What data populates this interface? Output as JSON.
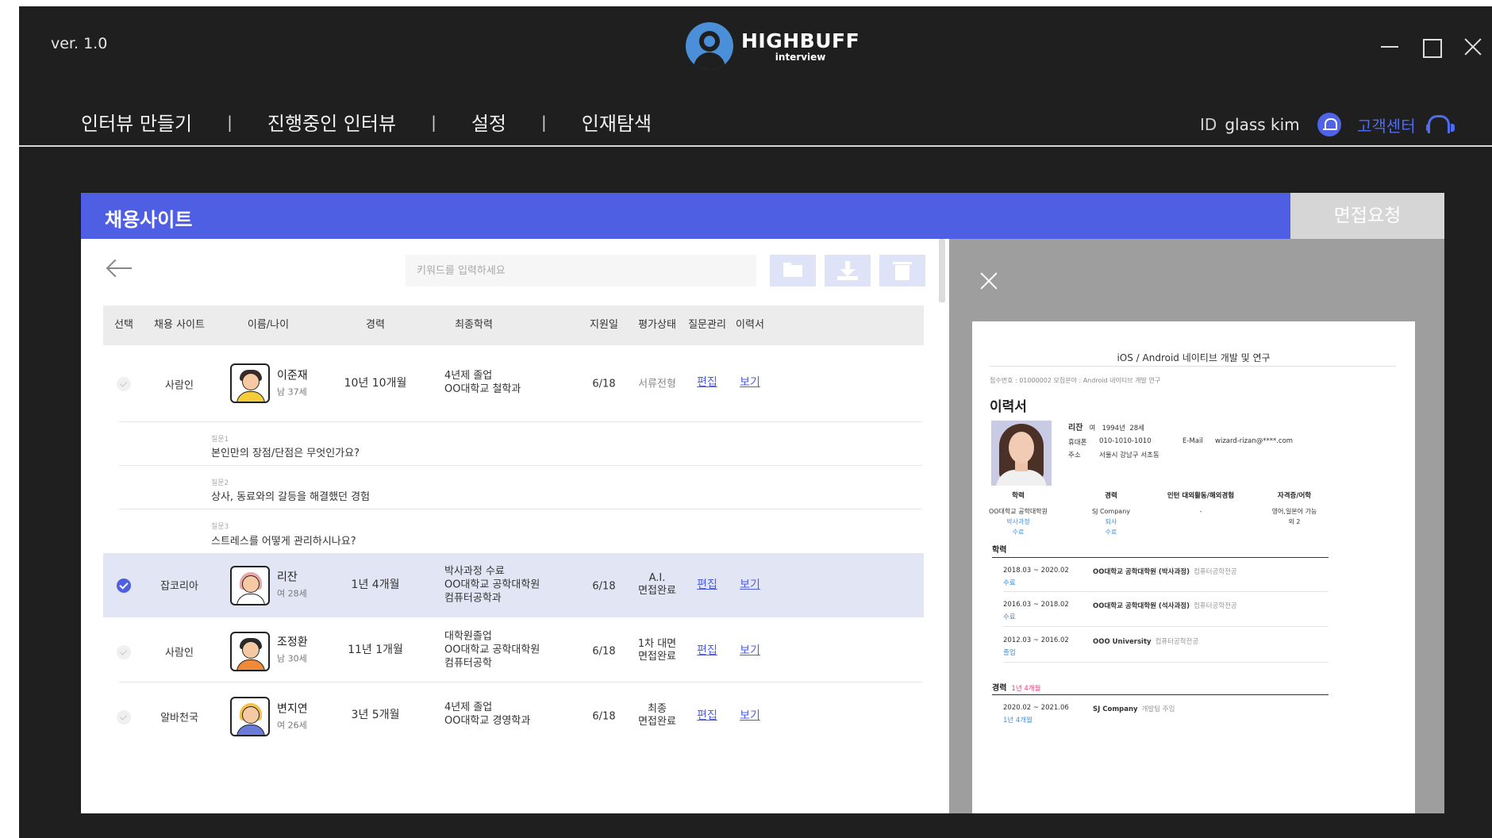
{
  "app": {
    "version": "ver. 1.0",
    "logo_main": "HIGHBUFF",
    "logo_sub": "interview"
  },
  "nav": {
    "items": [
      "인터뷰 만들기",
      "진행중인 인터뷰",
      "설정",
      "인재탐색"
    ],
    "separator": "|",
    "id_label": "ID",
    "user": "glass kim",
    "support": "고객센터"
  },
  "panel": {
    "title": "채용사이트",
    "request_button": "면접요청",
    "search_placeholder": "키워드를 입력하세요"
  },
  "table": {
    "headers": [
      "선택",
      "채용 사이트",
      "이름/나이",
      "경력",
      "최종학력",
      "지원일",
      "평가상태",
      "질문관리",
      "이력서"
    ],
    "rows": [
      {
        "selected": false,
        "site": "사람인",
        "name": "이준재",
        "meta": "남 37세",
        "career": "10년 10개월",
        "edu": [
          "4년제 졸업",
          "OO대학교 철학과"
        ],
        "date": "6/18",
        "status": [
          "서류전형"
        ],
        "edit": "편집",
        "view": "보기"
      },
      {
        "selected": true,
        "site": "잡코리아",
        "name": "리잔",
        "meta": "여 28세",
        "career": "1년 4개월",
        "edu": [
          "박사과정 수료",
          "OO대학교 공학대학원",
          "컴퓨터공학과"
        ],
        "date": "6/18",
        "status": [
          "A.I.",
          "면접완료"
        ],
        "edit": "편집",
        "view": "보기"
      },
      {
        "selected": false,
        "site": "사람인",
        "name": "조정환",
        "meta": "남 30세",
        "career": "11년 1개월",
        "edu": [
          "대학원졸업",
          "OO대학교 공학대학원",
          "컴퓨터공학"
        ],
        "date": "6/18",
        "status": [
          "1차 대면",
          "면접완료"
        ],
        "edit": "편집",
        "view": "보기"
      },
      {
        "selected": false,
        "site": "알바천국",
        "name": "변지연",
        "meta": "여 26세",
        "career": "3년 5개월",
        "edu": [
          "4년제 졸업",
          "OO대학교 경영학과"
        ],
        "date": "6/18",
        "status": [
          "최종",
          "면접완료"
        ],
        "edit": "편집",
        "view": "보기"
      }
    ],
    "questions": [
      {
        "label": "질문1",
        "text": "본인만의 장점/단점은 무엇인가요?"
      },
      {
        "label": "질문2",
        "text": "상사, 동료와의 갈등을 해결했던 경험"
      },
      {
        "label": "질문3",
        "text": "스트레스를 어떻게 관리하시나요?"
      }
    ]
  },
  "resume": {
    "title": "iOS / Android 네이티브 개발 및 연구",
    "meta": "접수번호 : 01000002      모집분야 : Android 네이티브 개발 연구",
    "heading": "이력서",
    "name": "리잔",
    "gender": "여",
    "birth": "1994년",
    "age": "28세",
    "phone_label": "휴대폰",
    "phone": "010-1010-1010",
    "email_label": "E-Mail",
    "email": "wizard-rizan@****.com",
    "address_label": "주소",
    "address": "서울시 강남구 서초동",
    "summary": [
      {
        "header": "학력",
        "value": "OO대학교 공학대학원",
        "blue": [
          "박사과정",
          "수료"
        ]
      },
      {
        "header": "경력",
        "value": "SJ Company",
        "blue": [
          "퇴사",
          "수료"
        ]
      },
      {
        "header": "인턴 대외활동/해외경험",
        "value": "-",
        "blue": []
      },
      {
        "header": "자격증/어학",
        "value": "영어,일본어 가능",
        "value2": "외 2",
        "blue": []
      }
    ],
    "education_title": "학력",
    "education": [
      {
        "period": "2018.03 ~ 2020.02",
        "status": "수료",
        "school": "OO대학교 공학대학원 (박사과정)",
        "major": "컴퓨터공학전공"
      },
      {
        "period": "2016.03 ~ 2018.02",
        "status": "수료",
        "school": "OO대학교 공학대학원 (석사과정)",
        "major": "컴퓨터공학전공"
      },
      {
        "period": "2012.03 ~ 2016.02",
        "status": "졸업",
        "school": "OOO University",
        "major": "컴퓨터공학전공"
      }
    ],
    "career_title": "경력",
    "career_total": "1년 4개월",
    "career": [
      {
        "period": "2020.02 ~ 2021.06",
        "duration": "1년 4개월",
        "company": "SJ Company",
        "role": "개발팀 주임"
      }
    ]
  },
  "colors": {
    "accent": "#4f5fe4",
    "link": "#4f5fe4",
    "background": "#1f1f1f",
    "request_button": "#d6d6d6"
  }
}
